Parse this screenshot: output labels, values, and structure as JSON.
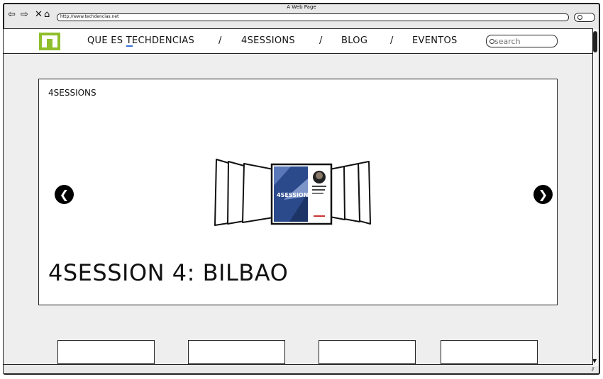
{
  "window": {
    "title": "A Web Page",
    "url": "http://www.techdencias.net"
  },
  "nav": {
    "items": [
      "QUE ES TECHDENCIAS",
      "4SESSIONS",
      "BLOG",
      "EVENTOS"
    ],
    "separator": "/"
  },
  "search": {
    "placeholder": "search"
  },
  "carousel": {
    "label": "4SESSIONS",
    "slide_title": "4SESSION 4: BILBAO",
    "cover_text": "4SESSIONS"
  },
  "colors": {
    "logo_green": "#8fbf2a",
    "cover_blue": "#2b4a8c",
    "link_underline": "#3a6fd8"
  }
}
